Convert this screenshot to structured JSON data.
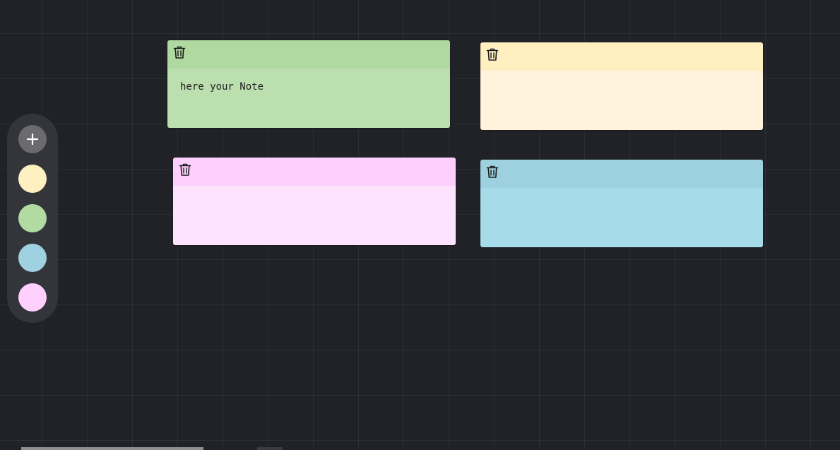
{
  "toolbar": {
    "add_icon": "plus-icon",
    "add_color": "#6b6b6e",
    "swatches": [
      {
        "name": "yellow",
        "color": "#fff0c2"
      },
      {
        "name": "green",
        "color": "#b2dba2"
      },
      {
        "name": "blue",
        "color": "#9fd1e0"
      },
      {
        "name": "pink",
        "color": "#ffd0fd"
      }
    ]
  },
  "notes": [
    {
      "color_name": "green",
      "header_color": "#afd9a0",
      "body_color": "#bcdfb0",
      "text": "here your Note",
      "delete_icon": "trash-icon"
    },
    {
      "color_name": "yellow",
      "header_color": "#ffefc1",
      "body_color": "#fff3de",
      "text": "",
      "delete_icon": "trash-icon"
    },
    {
      "color_name": "pink",
      "header_color": "#fdcffd",
      "body_color": "#fde3fd",
      "text": "",
      "delete_icon": "trash-icon"
    },
    {
      "color_name": "blue",
      "header_color": "#9ed1e0",
      "body_color": "#a6dce9",
      "text": "",
      "delete_icon": "trash-icon"
    }
  ]
}
